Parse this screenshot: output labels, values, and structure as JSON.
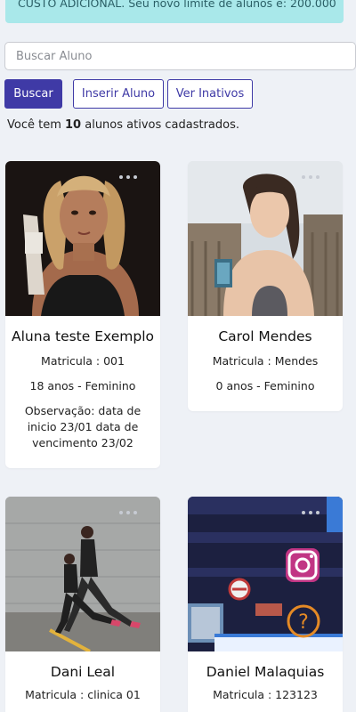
{
  "banner": {
    "text": "CUSTO ADICIONAL. Seu novo limite de alunos é: 200.000"
  },
  "search": {
    "placeholder": "Buscar Aluno"
  },
  "buttons": {
    "search": "Buscar",
    "insert": "Inserir Aluno",
    "inactive": "Ver Inativos"
  },
  "summary": {
    "prefix": "Você tem ",
    "count": "10",
    "suffix": " alunos ativos cadastrados."
  },
  "students": [
    {
      "name": "Aluna teste Exemplo",
      "matricula": "Matricula : 001",
      "info": "18 anos - Feminino",
      "obs": "Observação: data de inicio 23/01 data de vencimento 23/02"
    },
    {
      "name": "Carol Mendes",
      "matricula": "Matricula : Mendes",
      "info": "0 anos - Feminino"
    },
    {
      "name": "Dani Leal",
      "matricula": "Matricula : clinica 01"
    },
    {
      "name": "Daniel Malaquias",
      "matricula": "Matricula : 123123"
    }
  ],
  "colors": {
    "primary": "#3f3aa6",
    "banner_bg": "#a9e8ea",
    "page_bg": "#eef1f6"
  }
}
